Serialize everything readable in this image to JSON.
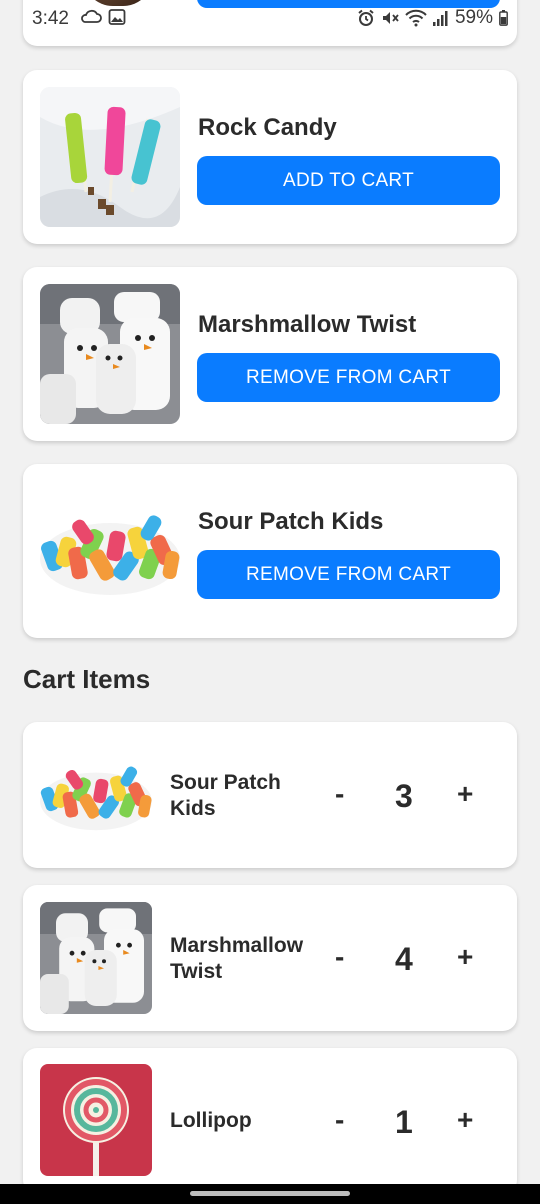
{
  "status_bar": {
    "time": "3:42",
    "battery": "59%",
    "icons": [
      "alarm-icon",
      "mute-icon",
      "wifi-icon",
      "signal-icon",
      "battery-icon"
    ]
  },
  "products": [
    {
      "name": "Rock Candy",
      "action_label": "ADD TO CART",
      "image": "rock-candy-image"
    },
    {
      "name": "Marshmallow Twist",
      "action_label": "REMOVE FROM CART",
      "image": "marshmallow-image"
    },
    {
      "name": "Sour Patch Kids",
      "action_label": "REMOVE FROM CART",
      "image": "sour-patch-image"
    }
  ],
  "cart_section": {
    "title": "Cart Items",
    "items": [
      {
        "name_line1": "Sour Patch",
        "name_line2": "Kids",
        "quantity": "3",
        "minus": "-",
        "plus": "+",
        "image": "sour-patch-image"
      },
      {
        "name_line1": "Marshmallow",
        "name_line2": "Twist",
        "quantity": "4",
        "minus": "-",
        "plus": "+",
        "image": "marshmallow-image"
      },
      {
        "name_line1": "Lollipop",
        "name_line2": "",
        "quantity": "1",
        "minus": "-",
        "plus": "+",
        "image": "lollipop-image"
      }
    ]
  },
  "colors": {
    "accent": "#0a7cff",
    "background": "#f1f1f1",
    "card": "#ffffff",
    "text": "#2b2b2b"
  }
}
